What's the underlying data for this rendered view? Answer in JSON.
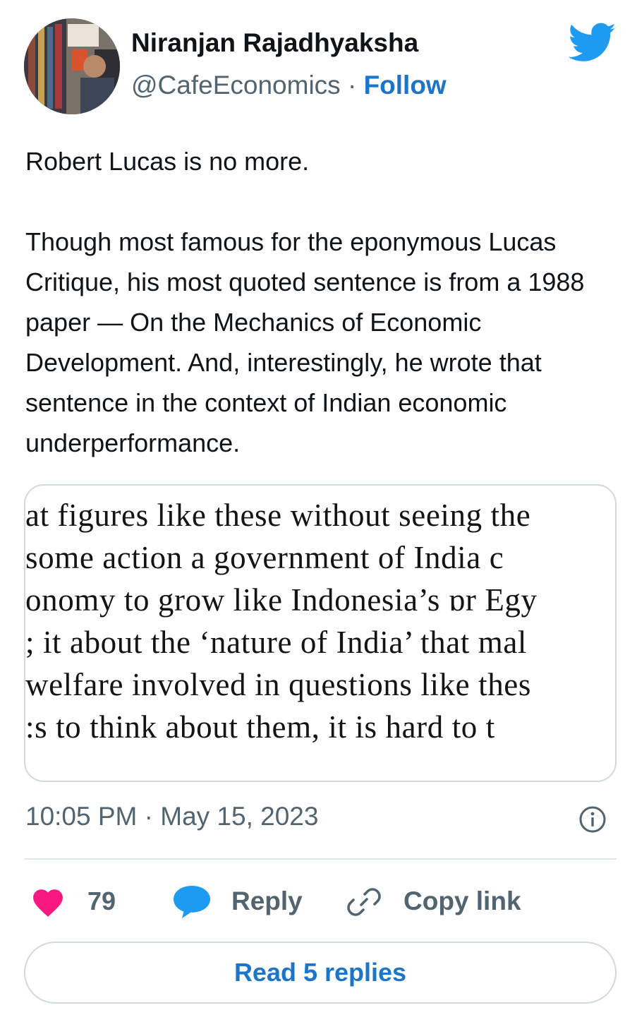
{
  "author": {
    "name": "Niranjan Rajadhyaksha",
    "handle": "@CafeEconomics",
    "separator": "·",
    "follow_label": "Follow"
  },
  "tweet": {
    "paragraphs": [
      "Robert Lucas is no more.",
      "Though most famous for the eponymous Lucas Critique, his most quoted sentence is from a 1988 paper — On the Mechanics of Economic Development. And, interestingly, he wrote that sentence in the context of Indian economic underperformance."
    ],
    "image_text_lines": [
      "at figures like these without seeing the",
      " some action a government of India c",
      "onomy to grow like Indonesia’s ɒr Egy",
      "; it about the ‘nature of India’ that mal",
      "welfare involved in questions like thes",
      ":s to think about them, it is hard to t"
    ]
  },
  "meta": {
    "timestamp": "10:05 PM · May 15, 2023"
  },
  "actions": {
    "like_count": "79",
    "reply_label": "Reply",
    "copy_link_label": "Copy link",
    "read_replies_label": "Read 5 replies"
  },
  "colors": {
    "accent": "#1d75c9",
    "twitter_bird": "#1d9bf0",
    "heart": "#f91880",
    "secondary_text": "#536471",
    "border": "#cfd9de"
  },
  "icons": {
    "brand": "twitter-bird-icon",
    "info": "info-icon",
    "like": "heart-icon",
    "reply": "speech-bubble-icon",
    "copy": "link-icon"
  }
}
